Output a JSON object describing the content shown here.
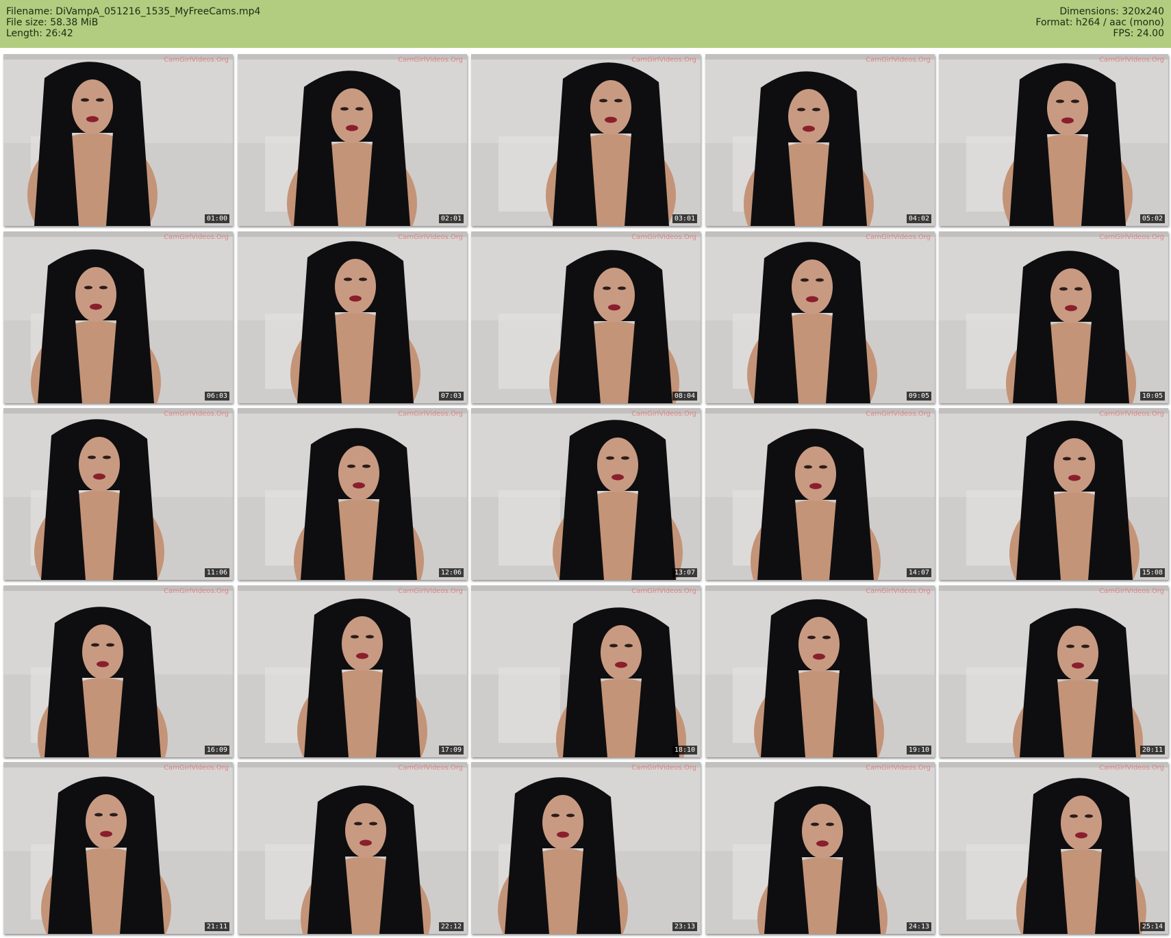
{
  "header": {
    "left": [
      "Filename: DiVampA_051216_1535_MyFreeCams.mp4",
      "File size: 58.38 MiB",
      "Length: 26:42"
    ],
    "right": [
      "Dimensions: 320x240",
      "Format: h264 / aac (mono)",
      "FPS: 24.00"
    ]
  },
  "watermark": "CamGirlVideos.Org",
  "thumbnails": [
    "01:00",
    "02:01",
    "03:01",
    "04:02",
    "05:02",
    "06:03",
    "07:03",
    "08:04",
    "09:05",
    "10:05",
    "11:06",
    "12:06",
    "13:07",
    "14:07",
    "15:08",
    "16:09",
    "17:09",
    "18:10",
    "19:10",
    "20:11",
    "21:11",
    "22:12",
    "23:13",
    "24:13",
    "25:14"
  ],
  "colors": {
    "header_bg": "#b2cd80",
    "wall": "#d6d4d3",
    "hair": "#0d0d0e",
    "skin": "#c99a82",
    "lips": "#8a1f2c"
  }
}
